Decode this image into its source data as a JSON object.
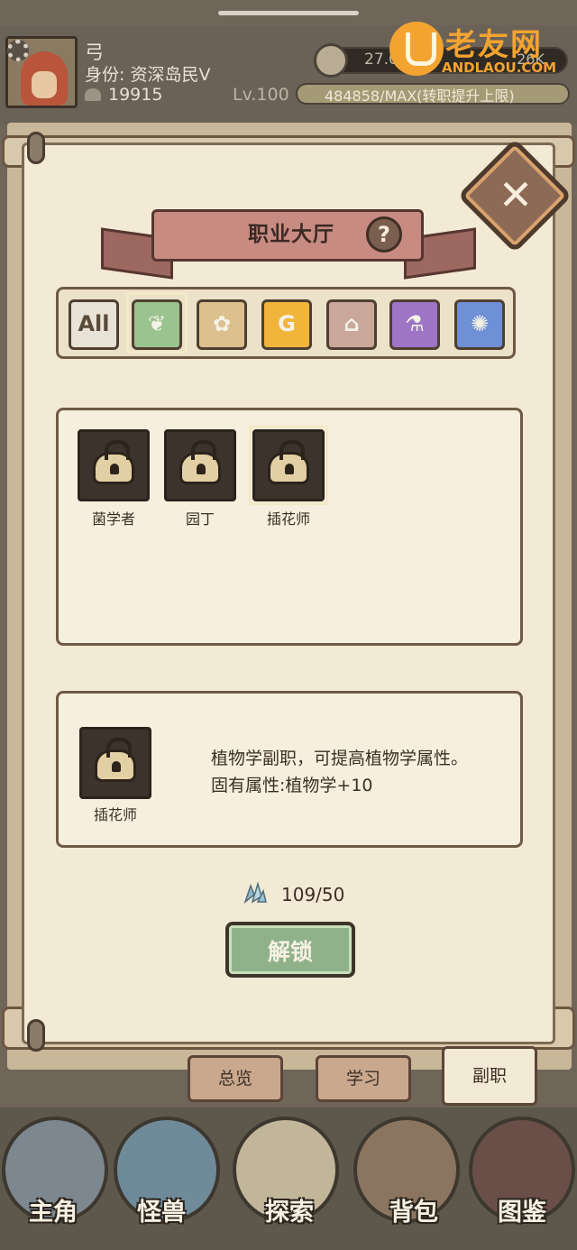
{
  "topbar": {
    "player_name": "弓",
    "identity": "身份: 资深岛民V",
    "power": "19915",
    "coins_primary": "27.0",
    "coins_secondary": ".26K",
    "level": "Lv.100",
    "xp_text": "484858/MAX(转职提升上限)",
    "xp_fraction": 1.0
  },
  "watermark": {
    "title": "老友网",
    "subtitle": "ANDLAOU.COM"
  },
  "panel": {
    "title": "职业大厅",
    "help_label": "?",
    "close_label": "✕"
  },
  "categories": [
    {
      "label": "All",
      "color": "#e9e3d7",
      "text_color": "#5a4a3a"
    },
    {
      "label": "❦",
      "color": "#9bc38f",
      "text_color": "#f4f1e6"
    },
    {
      "label": "✿",
      "color": "#dcc08d",
      "text_color": "#f4f1e6"
    },
    {
      "label": "G",
      "color": "#f0b53a",
      "text_color": "#f4f1e6"
    },
    {
      "label": "⌂",
      "color": "#c9a89a",
      "text_color": "#f4f1e6"
    },
    {
      "label": "⚗",
      "color": "#9d74c6",
      "text_color": "#f4f1e6"
    },
    {
      "label": "✺",
      "color": "#6f8fd6",
      "text_color": "#f4f1e6"
    }
  ],
  "jobs": [
    {
      "name": "菌学者"
    },
    {
      "name": "园丁"
    },
    {
      "name": "插花师"
    }
  ],
  "detail": {
    "name": "插花师",
    "description_line1": "植物学副职，可提高植物学属性。",
    "description_line2": "固有属性:植物学+10"
  },
  "cost": {
    "value": "109/50"
  },
  "unlock_button": {
    "label": "解锁"
  },
  "tabs": [
    {
      "label": "总览"
    },
    {
      "label": "学习"
    },
    {
      "label": "副职"
    }
  ],
  "bottom_nav": [
    {
      "label": "主角",
      "color": "#7c8790"
    },
    {
      "label": "怪兽",
      "color": "#6f8b9a"
    },
    {
      "label": "探索",
      "color": "#c2b69a"
    },
    {
      "label": "背包",
      "color": "#8b7560"
    },
    {
      "label": "图鉴",
      "color": "#6a4f49"
    }
  ],
  "colors": {
    "paper": "#f3ead5",
    "border": "#6e5a45",
    "accent_green": "#8fb28b",
    "ribbon": "#c88b82"
  }
}
